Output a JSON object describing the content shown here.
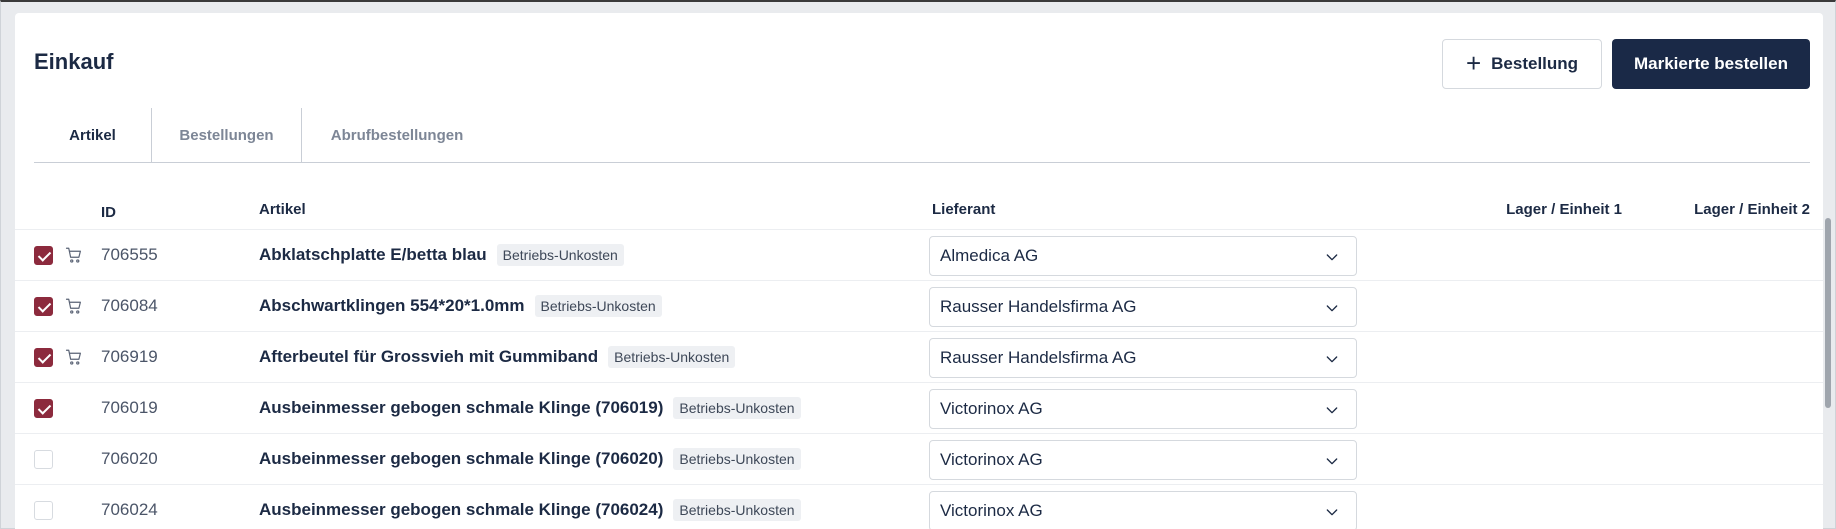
{
  "page": {
    "title": "Einkauf"
  },
  "actions": {
    "add_order_label": "Bestellung",
    "order_marked_label": "Markierte bestellen"
  },
  "tabs": [
    {
      "label": "Artikel",
      "active": true
    },
    {
      "label": "Bestellungen",
      "active": false
    },
    {
      "label": "Abrufbestellungen",
      "active": false
    }
  ],
  "table": {
    "headers": {
      "id": "ID",
      "artikel": "Artikel",
      "lieferant": "Lieferant",
      "lager1": "Lager / Einheit 1",
      "lager2": "Lager / Einheit 2"
    },
    "rows": [
      {
        "checked": true,
        "cart": true,
        "id": "706555",
        "name": "Abklatschplatte E/betta blau",
        "badge": "Betriebs-Unkosten",
        "supplier": "Almedica AG"
      },
      {
        "checked": true,
        "cart": true,
        "id": "706084",
        "name": "Abschwartklingen 554*20*1.0mm",
        "badge": "Betriebs-Unkosten",
        "supplier": "Rausser Handelsfirma AG"
      },
      {
        "checked": true,
        "cart": true,
        "id": "706919",
        "name": "Afterbeutel für Grossvieh mit Gummiband",
        "badge": "Betriebs-Unkosten",
        "supplier": "Rausser Handelsfirma AG"
      },
      {
        "checked": true,
        "cart": false,
        "id": "706019",
        "name": "Ausbeinmesser gebogen schmale Klinge (706019)",
        "badge": "Betriebs-Unkosten",
        "supplier": "Victorinox AG"
      },
      {
        "checked": false,
        "cart": false,
        "id": "706020",
        "name": "Ausbeinmesser gebogen schmale Klinge (706020)",
        "badge": "Betriebs-Unkosten",
        "supplier": "Victorinox AG"
      },
      {
        "checked": false,
        "cart": false,
        "id": "706024",
        "name": "Ausbeinmesser gebogen schmale Klinge (706024)",
        "badge": "Betriebs-Unkosten",
        "supplier": "Victorinox AG"
      }
    ]
  },
  "icons": {
    "plus": "plus-icon",
    "cart": "cart-icon",
    "chevron": "chevron-down-icon",
    "check": "check-icon"
  },
  "colors": {
    "primary": "#1a2947",
    "checkbox_checked": "#8c2a3d",
    "text": "#1c2a44",
    "muted": "#7d8696"
  }
}
